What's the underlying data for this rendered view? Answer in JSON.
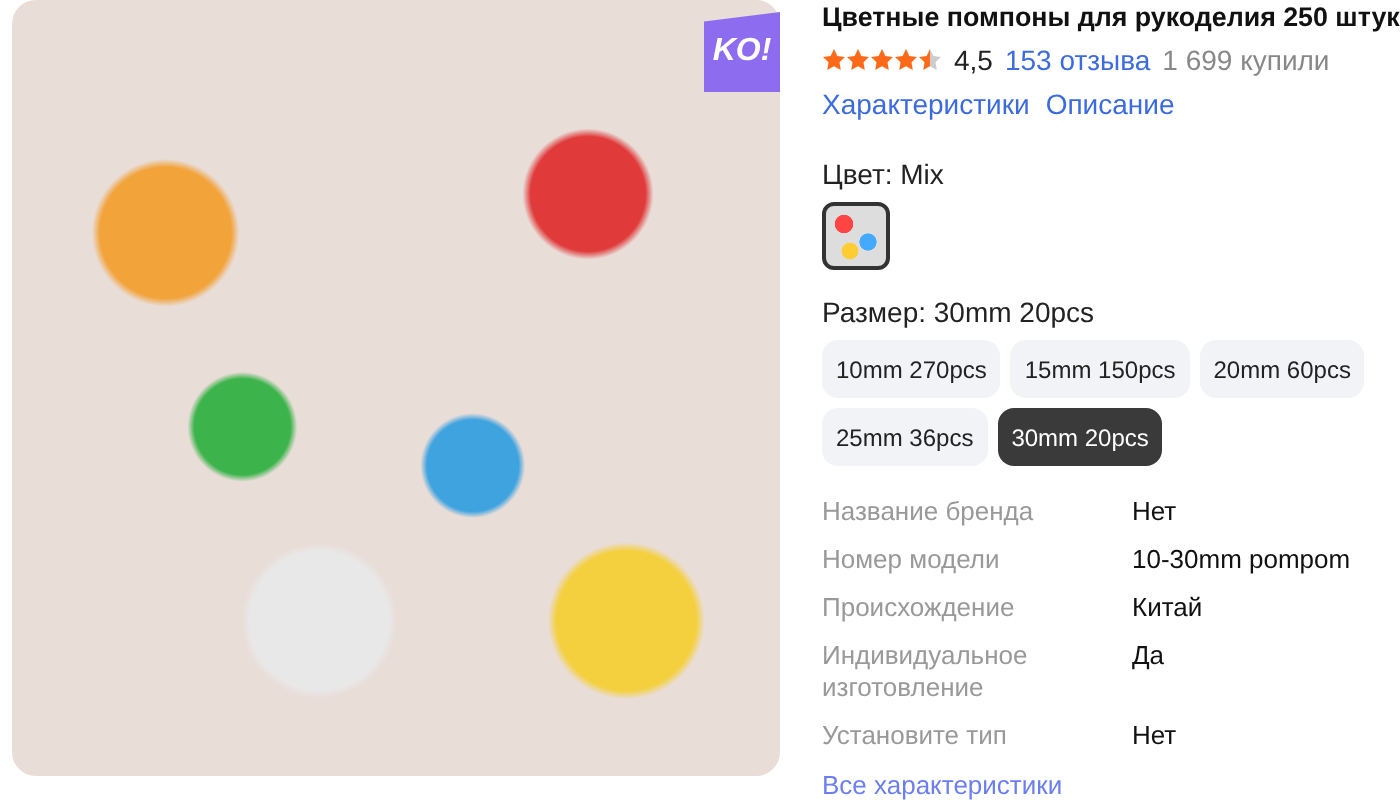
{
  "photo": {
    "badge": "KO!"
  },
  "product": {
    "title": "Цветные помпоны для рукоделия 250 штук",
    "stars": 4.5,
    "rating": "4,5",
    "reviews": "153 отзыва",
    "bought": "1 699 купили"
  },
  "links": [
    {
      "label": "Характеристики"
    },
    {
      "label": "Описание"
    }
  ],
  "color": {
    "label": "Цвет: Mix",
    "swatches": [
      {
        "selected": true
      }
    ]
  },
  "size": {
    "label": "Размер: 30mm 20pcs",
    "options": [
      {
        "label": "10mm 270pcs",
        "selected": false
      },
      {
        "label": "15mm 150pcs",
        "selected": false
      },
      {
        "label": "20mm 60pcs",
        "selected": false
      },
      {
        "label": "25mm 36pcs",
        "selected": false
      },
      {
        "label": "30mm 20pcs",
        "selected": true
      }
    ]
  },
  "specs": [
    {
      "name": "Название бренда",
      "value": "Нет"
    },
    {
      "name": "Номер модели",
      "value": "10-30mm pompom"
    },
    {
      "name": "Происхождение",
      "value": "Китай"
    },
    {
      "name": "Индивидуальное изготовление",
      "value": "Да"
    },
    {
      "name": "Установите тип",
      "value": "Нет"
    }
  ],
  "all_specs_link": "Все характеристики"
}
